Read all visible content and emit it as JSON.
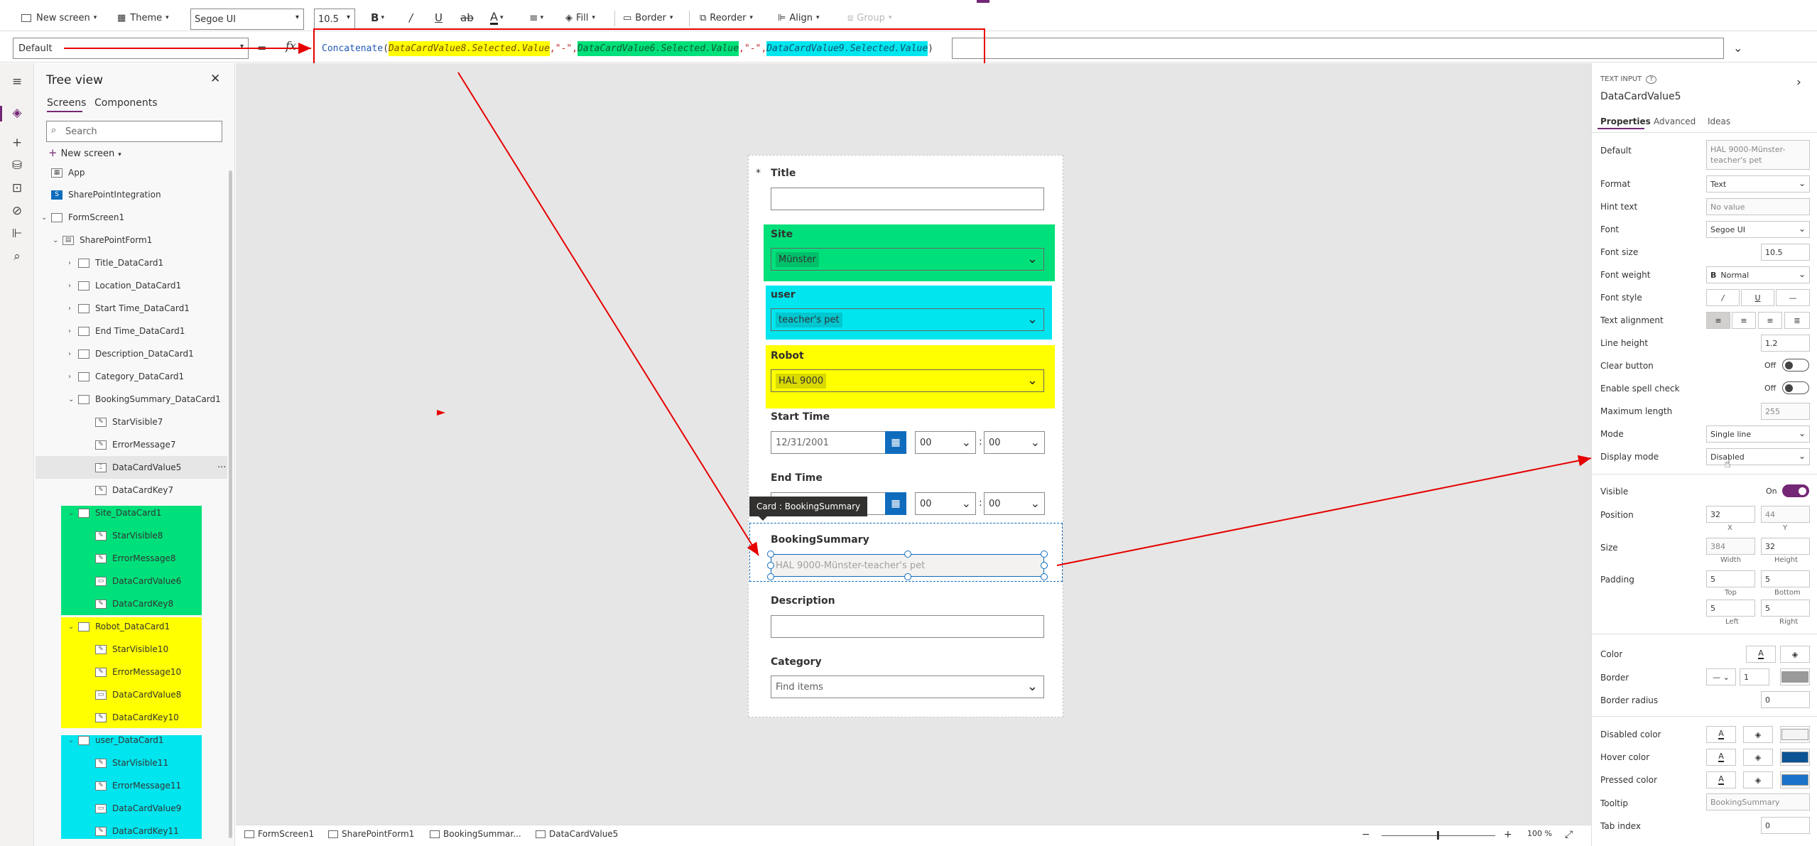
{
  "toolbar": {
    "new_screen": "New screen",
    "theme": "Theme",
    "font": "Segoe UI",
    "font_size": "10.5",
    "bold": "B",
    "italic": "/",
    "underline": "U",
    "fill": "Fill",
    "border": "Border",
    "reorder": "Reorder",
    "align": "Align",
    "group": "Group"
  },
  "formula_bar": {
    "property": "Default",
    "equals": "=",
    "fx": "fx",
    "func": "Concatenate",
    "open": "(",
    "arg1": "DataCardValue8.Selected.Value",
    "sep1": ",\"-\",",
    "arg2": "DataCardValue6.Selected.Value",
    "sep2": ",\"-\",",
    "arg3": "DataCardValue9.Selected.Value",
    "close": ")"
  },
  "tree": {
    "title": "Tree view",
    "tabs": [
      "Screens",
      "Components"
    ],
    "search_placeholder": "Search",
    "new_screen": "New screen",
    "nodes": [
      "App",
      "SharePointIntegration",
      "FormScreen1",
      "SharePointForm1",
      "Title_DataCard1",
      "Location_DataCard1",
      "Start Time_DataCard1",
      "End Time_DataCard1",
      "Description_DataCard1",
      "Category_DataCard1",
      "BookingSummary_DataCard1",
      "StarVisible7",
      "ErrorMessage7",
      "DataCardValue5",
      "DataCardKey7",
      "Site_DataCard1",
      "StarVisible8",
      "ErrorMessage8",
      "DataCardValue6",
      "DataCardKey8",
      "Robot_DataCard1",
      "StarVisible10",
      "ErrorMessage10",
      "DataCardValue8",
      "DataCardKey10",
      "user_DataCard1",
      "StarVisible11",
      "ErrorMessage11",
      "DataCardValue9",
      "DataCardKey11"
    ],
    "more": "···"
  },
  "form": {
    "required": "*",
    "title_label": "Title",
    "site_label": "Site",
    "site_value": "Münster",
    "user_label": "user",
    "user_value": "teacher's pet",
    "robot_label": "Robot",
    "robot_value": "HAL 9000",
    "start_label": "Start Time",
    "start_date": "12/31/2001",
    "start_hour": "00",
    "start_min": "00",
    "end_label": "End Time",
    "end_hour": "00",
    "end_min": "00",
    "colon": ":",
    "tooltip": "Card : BookingSummary",
    "summary_label": "BookingSummary",
    "summary_value": "HAL 9000-Münster-teacher's pet",
    "description_label": "Description",
    "category_label": "Category",
    "category_placeholder": "Find items"
  },
  "props": {
    "control_type": "TEXT INPUT",
    "control_name": "DataCardValue5",
    "tabs": [
      "Properties",
      "Advanced",
      "Ideas"
    ],
    "default_label": "Default",
    "default_value": "HAL 9000-Münster-teacher's pet",
    "format_label": "Format",
    "format_value": "Text",
    "hint_label": "Hint text",
    "hint_value": "No value",
    "font_label": "Font",
    "font_value": "Segoe UI",
    "font_size_label": "Font size",
    "font_size_value": "10.5",
    "font_weight_label": "Font weight",
    "font_weight_value": "Normal",
    "font_style_label": "Font style",
    "text_align_label": "Text alignment",
    "line_height_label": "Line height",
    "line_height_value": "1.2",
    "clear_label": "Clear button",
    "clear_value": "Off",
    "spell_label": "Enable spell check",
    "spell_value": "Off",
    "maxlen_label": "Maximum length",
    "maxlen_value": "255",
    "mode_label": "Mode",
    "mode_value": "Single line",
    "display_label": "Display mode",
    "display_value": "Disabled",
    "visible_label": "Visible",
    "visible_value": "On",
    "position_label": "Position",
    "pos_x": "32",
    "pos_y": "44",
    "x_note": "X",
    "y_note": "Y",
    "size_label": "Size",
    "width": "384",
    "height": "32",
    "width_note": "Width",
    "height_note": "Height",
    "padding_label": "Padding",
    "pad_top": "5",
    "pad_bottom": "5",
    "pad_left": "5",
    "pad_right": "5",
    "top_note": "Top",
    "bottom_note": "Bottom",
    "left_note": "Left",
    "right_note": "Right",
    "color_label": "Color",
    "border_label": "Border",
    "border_width": "1",
    "radius_label": "Border radius",
    "radius_value": "0",
    "disabled_color_label": "Disabled color",
    "hover_color_label": "Hover color",
    "pressed_color_label": "Pressed color",
    "tooltip_label": "Tooltip",
    "tooltip_value": "BookingSummary",
    "tabindex_label": "Tab index",
    "tabindex_value": "0"
  },
  "status": {
    "crumbs": [
      "FormScreen1",
      "SharePointForm1",
      "BookingSummar...",
      "DataCardValue5"
    ],
    "zoom_minus": "−",
    "zoom_plus": "+",
    "zoom": "100 %"
  },
  "colors": {
    "yellow": "#ffff00",
    "green": "#00e07a",
    "cyan": "#00e5ee",
    "annotation_red": "#e60000",
    "accent": "#742774"
  },
  "icons": [
    "chevron-down-icon",
    "fx-icon",
    "calendar-icon",
    "close-icon",
    "search-icon",
    "hamburger-icon",
    "layers-icon",
    "plus-icon",
    "database-icon",
    "media-icon",
    "variables-icon",
    "tools-icon",
    "search-nav-icon",
    "expand-icon"
  ]
}
